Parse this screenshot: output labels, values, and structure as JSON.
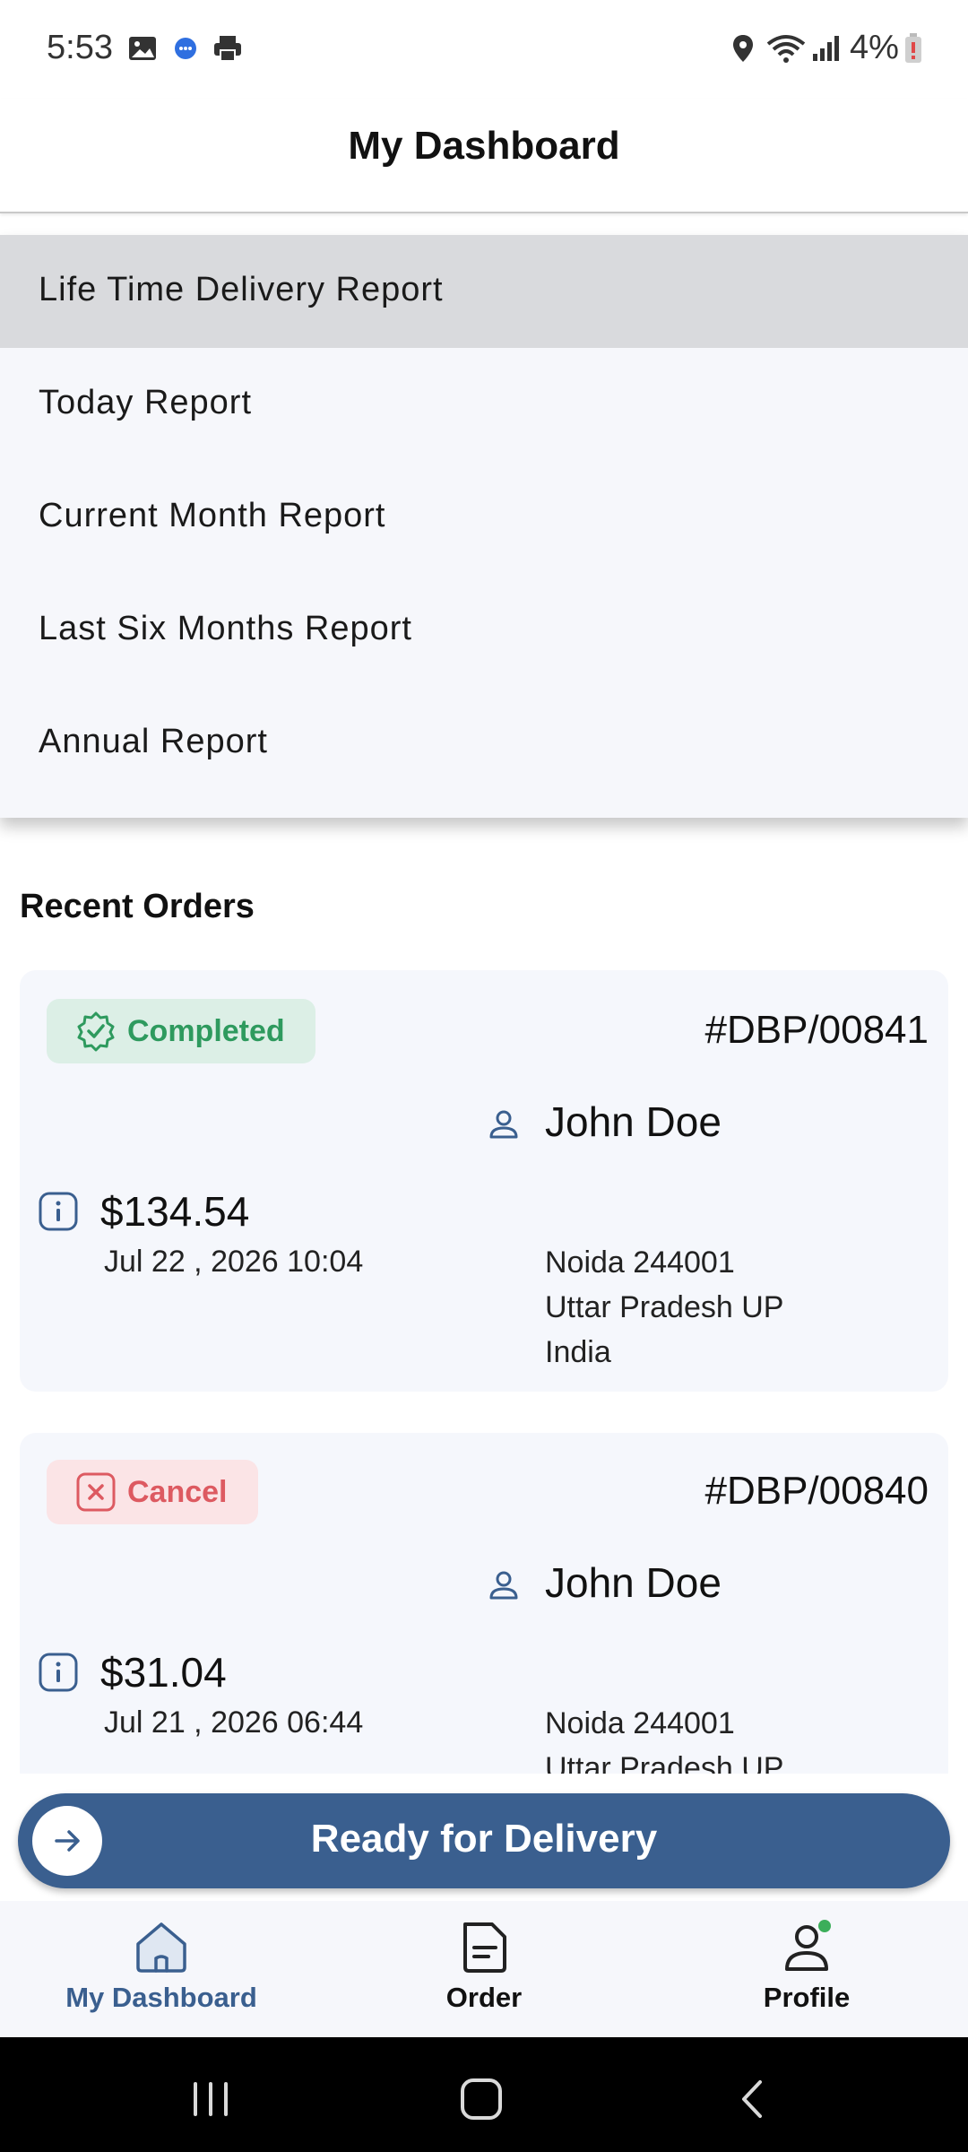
{
  "status_bar": {
    "time": "5:53",
    "battery": "4%"
  },
  "header": {
    "title": "My Dashboard"
  },
  "menu": {
    "items": [
      {
        "label": "Life Time Delivery Report",
        "selected": true
      },
      {
        "label": "Today Report",
        "selected": false
      },
      {
        "label": "Current Month Report",
        "selected": false
      },
      {
        "label": "Last Six Months Report",
        "selected": false
      },
      {
        "label": "Annual Report",
        "selected": false
      }
    ]
  },
  "recent_orders": {
    "title": "Recent Orders",
    "orders": [
      {
        "status": "Completed",
        "order_id": "#DBP/00841",
        "customer": "John Doe",
        "amount": "$134.54",
        "date": "Jul 22 , 2026 10:04",
        "address": [
          "Noida 244001",
          "Uttar Pradesh UP",
          "India"
        ]
      },
      {
        "status": "Cancel",
        "order_id": "#DBP/00840",
        "customer": "John Doe",
        "amount": "$31.04",
        "date": "Jul 21 , 2026 06:44",
        "address": [
          "Noida 244001",
          "Uttar Pradesh UP"
        ]
      }
    ]
  },
  "ready_button": {
    "label": "Ready for Delivery"
  },
  "bottom_nav": {
    "items": [
      {
        "label": "My Dashboard",
        "icon": "home-icon",
        "active": true
      },
      {
        "label": "Order",
        "icon": "document-icon",
        "active": false
      },
      {
        "label": "Profile",
        "icon": "person-icon",
        "active": false
      }
    ]
  },
  "colors": {
    "accent": "#3a5f8f",
    "completed_bg": "#dcefe6",
    "completed_fg": "#2e9a5e",
    "cancel_bg": "#fbe4e6",
    "cancel_fg": "#dd5a61",
    "profile_dot": "#3cae5a"
  }
}
